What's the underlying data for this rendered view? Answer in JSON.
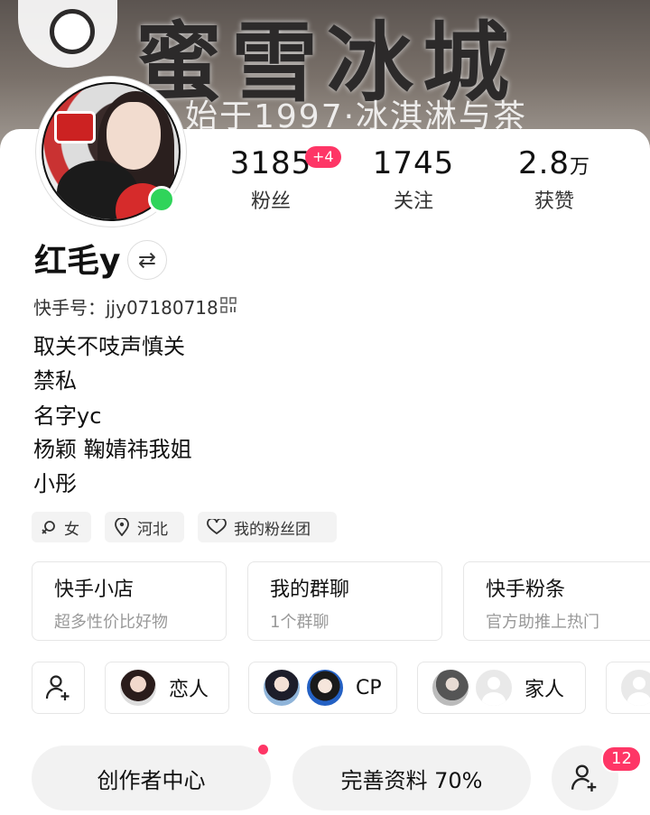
{
  "banner": {
    "sign_text": "蜜雪冰城",
    "sub_text": "始于1997·冰淇淋与茶"
  },
  "stats": {
    "fans": {
      "value": "3185",
      "label": "粉丝",
      "new_badge": "+4"
    },
    "following": {
      "value": "1745",
      "label": "关注"
    },
    "likes": {
      "value": "2.8",
      "unit": "万",
      "label": "获赞"
    }
  },
  "profile": {
    "name": "红毛y",
    "kuaishou_id_label": "快手号：",
    "kuaishou_id": "jjy07180718",
    "bio": [
      "取关不吱声慎关",
      "禁私",
      "名字yc",
      "杨颖  鞠婧祎我姐",
      "小彤"
    ]
  },
  "tags": {
    "gender": "女",
    "location": "河北",
    "fan_group": "我的粉丝团"
  },
  "cards": [
    {
      "title": "快手小店",
      "subtitle": "超多性价比好物"
    },
    {
      "title": "我的群聊",
      "subtitle": "1个群聊"
    },
    {
      "title": "快手粉条",
      "subtitle": "官方助推上热门"
    }
  ],
  "relations": {
    "lover": "恋人",
    "cp": "CP",
    "family": "家人"
  },
  "bottom": {
    "creator_center": "创作者中心",
    "complete_profile": "完善资料 70%",
    "friend_requests_count": "12"
  },
  "colors": {
    "accent": "#fe3666",
    "online": "#2fd45a"
  }
}
